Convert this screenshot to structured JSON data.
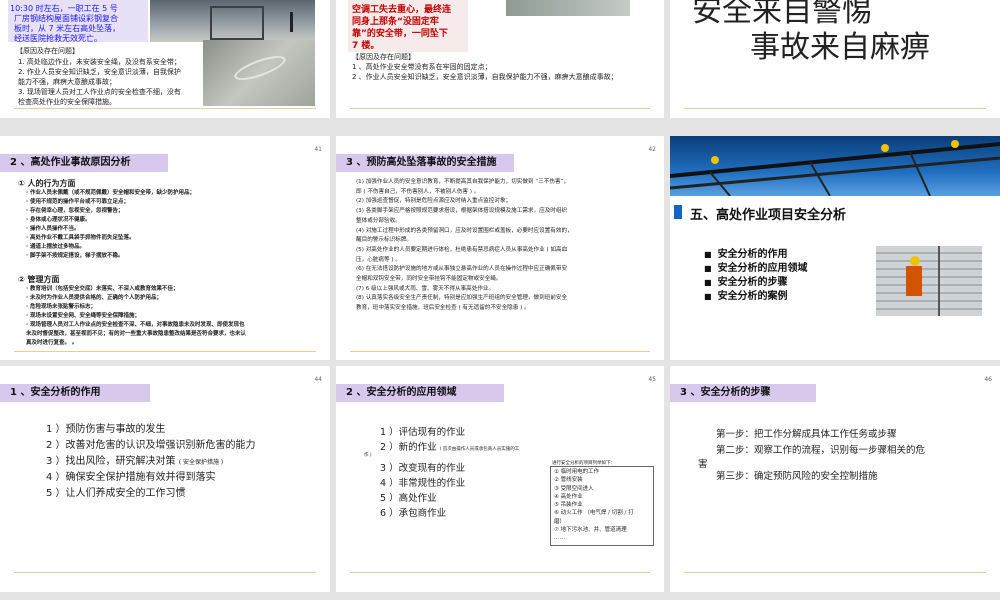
{
  "s1": {
    "blue": [
      "10:30 时左右，一职工在 5 号",
      "厂房钢结构屋面铺设彩钢复合",
      "板时，从 7 米左右高处坠落，",
      "经送医院抢救无效死亡。"
    ],
    "reason_title": "【原因及存在问题】",
    "reasons": [
      "1. 高处临边作业，未安装安全绳，及没有系安全带；",
      "2. 作业人员安全知识缺乏，安全意识淡薄，自我保护",
      "能力不强，麻痹大意酿成事故；",
      "3. 现场管理人员对工人作业点的安全检查不细，没有",
      "检查高处作业的安全保障措施。"
    ]
  },
  "s2": {
    "red": [
      "空调工失去重心，最终连",
      "同身上那条“没固定牢",
      "靠”的安全带，一同坠下",
      "7 楼。"
    ],
    "reason_title": "【原因及存在问题】",
    "reasons": [
      "1 、高处作业安全带没有系在牢固的固定点；",
      "2 、作业人员安全知识缺乏，安全意识淡薄，自我保护能力不强，麻痹大意酿成事故；"
    ]
  },
  "s3": {
    "line1": "安全来自警惕",
    "line2": "事故来自麻痹"
  },
  "s4": {
    "num": "41",
    "title": "2 、高处作业事故原因分析",
    "h1": "①  人的行为方面",
    "items1": [
      "· 作业人员未佩戴（或不规范佩戴）安全帽和安全带，缺少防护用品；",
      "· 使用不规范的操作平台或不可靠立足点；",
      "· 存在侥幸心理，忽视安全，忽视警告；",
      "· 身体或心理状况不健康。",
      "· 操作人员操作不当。",
      "· 高处作业不戴工具袋手抓物件而失足坠落。",
      "· 通道上摆放过多物品。",
      "· 脚手架不按规定搭设，梯子摆放不稳。"
    ],
    "h2": "②  管理方面",
    "items2": [
      "· 教育培训（包括安全交底）未落实、不深入或教育效果不佳；",
      "· 未及时为作业人员提供合格的、正确的个人防护用品；",
      "· 危险现场未张贴警示标志；",
      "· 现场未设置安全网、安全绳等安全保障措施；",
      "· 现场管理人员对工人作业点的安全检查不深、不细，对事故隐患未及时发现、即使发现也",
      "未及时督促整改，甚至视而不见；有的对一些重大事故隐患整改结果是否符合要求，也未认",
      "真及时进行复查。 。"
    ]
  },
  "s5": {
    "num": "42",
    "title": "3 、预防高处坠落事故的安全措施",
    "items": [
      "(1)  加强作业人员的安全意识教育，不断提高其自我保护能力，切实做到 “三不伤害”，",
      "即 ( 不伤害自己，不伤害别人，不被别人伤害 ) 。",
      "(2)  加强巡查督促，特别是危险点源应及时纳入重点监控对象；",
      "(3) 各类脚手架应严格按照规范要求搭设，根据架体搭设规模及施工需求，应及时组织",
      "整体或分部验收。",
      "(4)  对施工过程中形成的各类预留洞口，应及时设置围栏或盖板，必要时应设置有效的，",
      "醒目的警示标识标牌。",
      "(5)  对高处作业的人员要定期进行体检，杜绝患有禁忌病症人员从事高处作业 ( 如高血",
      "压，心脏病等 ) 。",
      "(6)  在无法搭设防护设施的地方或从事独立悬高作业的人员在操作过程中应正确佩带安",
      "全帽和双钩安全带，同时安全带挂钩不能固定物或安全绳。",
      "(7) 6 级以上强风或大雨、雪、雾天不得从事高处作业。",
      "(8)  认真落实各级安全生产责任制，特别是应加强生产班组的安全管理，做到班前安全",
      "教育，班中落实安全措施，班后安全检查 ( 有无遗留的不安全隐患 ) 。"
    ]
  },
  "s6": {
    "title": "五、高处作业项目安全分析",
    "bullets": [
      "安全分析的作用",
      "安全分析的应用领域",
      "安全分析的步骤",
      "安全分析的案例"
    ],
    "colors": {
      "accent": "#1565c0"
    }
  },
  "s7": {
    "num": "44",
    "title": "1 、安全分析的作用",
    "items": [
      "1 ）预防伤害与事故的发生",
      "2 ）改善对危害的认识及增强识别新危害的能力",
      "3 ）找出风险，研究解决对策",
      "4 ）确保安全保护措施有效并得到落实",
      "5 ）让人们养成安全的工作习惯"
    ],
    "small": "( 安全保护措施 )"
  },
  "s8": {
    "num": "45",
    "title": "2 、安全分析的应用领域",
    "items": [
      "1 ）评估现有的作业",
      "2 ）新的作业",
      "3 ）改变现有的作业",
      "4 ）非常规性的作业",
      "5 ）高处作业",
      "6 ）承包商作业"
    ],
    "small": "( 首次由操作人员或承包商人员实施的工",
    "small2": "作 )",
    "box_title": "进行安全分析的项目列举如下：",
    "box_items": [
      "① 临时用电的工作",
      "② 管线安装",
      "③ 受限空间进入",
      "④ 高处作业",
      "⑤ 吊装作业",
      "⑥ 动火工作 （电气焊 / 切割 / 打",
      "磨）",
      "⑦ 地下污水池、井、管道清理",
      "……"
    ]
  },
  "s9": {
    "num": "46",
    "title": "3 、安全分析的步骤",
    "steps": [
      "第一步：把工作分解成具体工作任务或步骤",
      "第二步：观察工作的流程，识别每一步骤相关的危",
      "害",
      "第三步：确定预防风险的安全控制措施"
    ]
  }
}
